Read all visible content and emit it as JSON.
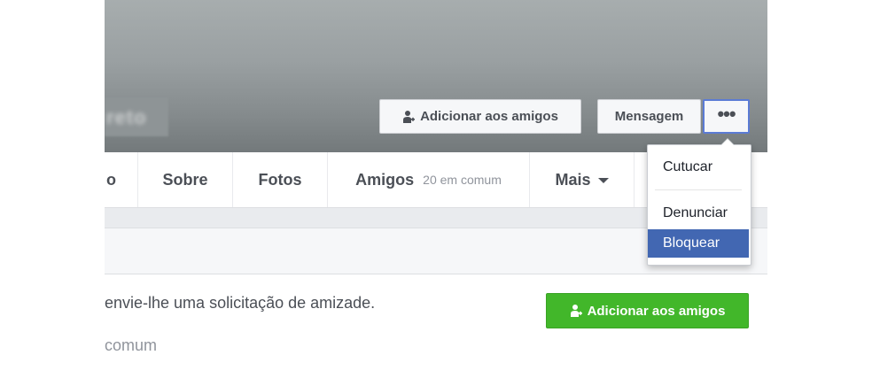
{
  "cover": {
    "name_fragment": "reto",
    "add_friend_label": "Adicionar aos amigos",
    "message_label": "Mensagem",
    "more_label": "•••"
  },
  "nav": {
    "prev_fragment": "o",
    "tabs": [
      {
        "label": "Sobre"
      },
      {
        "label": "Fotos"
      },
      {
        "label": "Amigos",
        "sub": "20 em comum"
      },
      {
        "label": "Mais"
      }
    ]
  },
  "dropdown": {
    "items": [
      "Cutucar",
      "Denunciar",
      "Bloquear"
    ],
    "highlighted": "Bloquear"
  },
  "body": {
    "text1": "envie-lhe uma solicitação de amizade.",
    "text2": "comum",
    "add_friend_label": "Adicionar aos amigos"
  },
  "colors": {
    "accent": "#4267b2",
    "green": "#42b72a",
    "focus_border": "#5b7bd5"
  },
  "icons": {
    "add_friend": "add-friend-icon",
    "more": "ellipsis-icon",
    "caret": "caret-down-icon"
  }
}
